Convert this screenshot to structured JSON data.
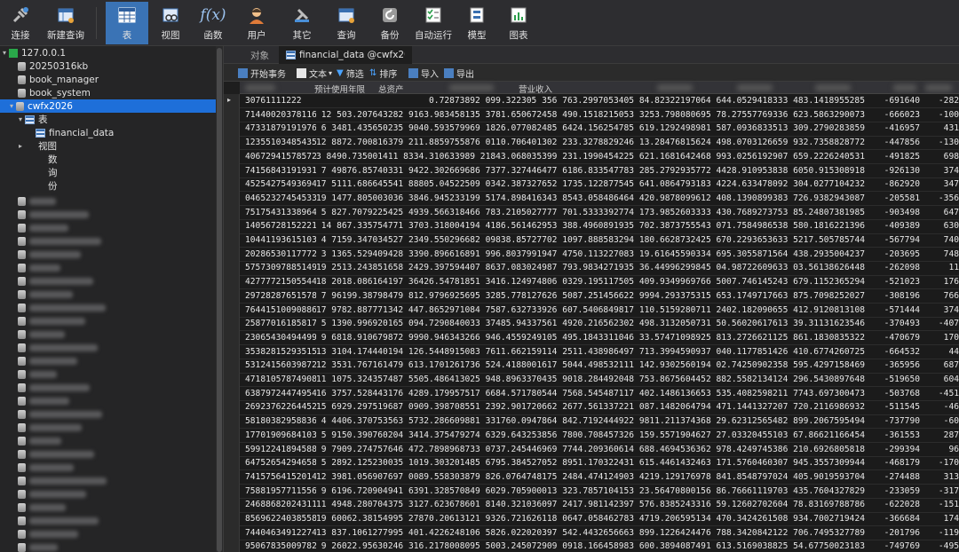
{
  "toolbar": {
    "items": [
      {
        "label": "连接",
        "icon": "connect-icon"
      },
      {
        "label": "新建查询",
        "icon": "new-query-icon"
      },
      {
        "label": "表",
        "icon": "table-icon"
      },
      {
        "label": "视图",
        "icon": "view-icon"
      },
      {
        "label": "函数",
        "icon": "function-icon"
      },
      {
        "label": "用户",
        "icon": "user-icon"
      },
      {
        "label": "其它",
        "icon": "other-icon"
      },
      {
        "label": "查询",
        "icon": "query-icon"
      },
      {
        "label": "备份",
        "icon": "backup-icon"
      },
      {
        "label": "自动运行",
        "icon": "auto-run-icon"
      },
      {
        "label": "模型",
        "icon": "model-icon"
      },
      {
        "label": "图表",
        "icon": "chart-icon"
      }
    ]
  },
  "sidebar": {
    "connection": "127.0.0.1",
    "databases": [
      "20250316kb",
      "book_manager",
      "book_system",
      "cwfx2026"
    ],
    "tables_label": "表",
    "table_name": "financial_data",
    "views_label": "视图",
    "functions_label": "数",
    "queries_label": "询",
    "backups_label": "份"
  },
  "tabs": {
    "objects": "对象",
    "active": "financial_data @cwfx2026 (127.0.0..."
  },
  "subtoolbar": {
    "begin_transaction": "开始事务",
    "text": "文本",
    "filter": "筛选",
    "sort": "排序",
    "import": "导入",
    "export": "导出"
  },
  "columns": {
    "c2": "预计使用年限",
    "c3": "总资产",
    "c4": "营业收入"
  },
  "rows": [
    {
      "id": "30761111222",
      "nums": "...",
      "n1": "-691640",
      "n2": "-282"
    },
    {
      "id": "71440020378116",
      "nums": "12 503.207643282 9163.983458135 3781.650672458 490.1518215053 3253.798080695 78.27557769336 623.5863290073",
      "n1": "-666023",
      "n2": "-100"
    },
    {
      "id": "47331879191976​2",
      "nums": "6 3481.435650235 9040.593579969 1826.077082485 6424.156254785 619.1292498981 587.0936833513 309.2790283859",
      "n1": "-416957",
      "n2": "431"
    },
    {
      "id": "12355103485435​4",
      "nums": "12 8872.700816379 211.8859755876 0110.706401302 233.3278829246 13.28476815624 498.0703126659 932.7358828772",
      "n1": "-447856",
      "n2": "-130"
    },
    {
      "id": "40672941578572",
      "nums": "3 8490.735001411 8334.310633989 21843.068035399 231.1990454225 621.1681642468 993.0256192907 659.2226240531",
      "n1": "-491825",
      "n2": "698"
    },
    {
      "id": "74156843191931",
      "nums": "7 49876.85740331 9422.302669686 7377.327446477 6186.833547783 285.2792935772 4428.910953838 6050.915308918",
      "n1": "-926130",
      "n2": "374"
    },
    {
      "id": "45254275493694",
      "nums": "17 5111.686645541 88805.04522509 0342.387327652 1735.122877545 641.0864793183 4224.633478092 304.0277104232",
      "n1": "-862920",
      "n2": "347"
    },
    {
      "id": "04652327454533",
      "nums": "19 1477.805003036 3846.945233199 5174.898416343 8543.058486464 420.9878099612 408.1390899383 726.9382943087",
      "n1": "-205581",
      "n2": "-356"
    },
    {
      "id": "75175431338964",
      "nums": "5 827.7079225425 4939.566318466 783.2105027777 701.5333392774 173.9852603333 430.7689273753 85.24807381985",
      "n1": "-903498",
      "n2": "647"
    },
    {
      "id": "14056728152221",
      "nums": "14 867.335754771 3703.318004194 4186.561462953 388.4960891935 702.3873755543 071.7584986538 580.1816221396",
      "n1": "-409389",
      "n2": "630"
    },
    {
      "id": "10441193615103​7",
      "nums": "4 7159.347034527 2349.550296682 09838.85727702 1097.888583294 180.6628732425 670.2293653633 5217.505785744",
      "n1": "-567794",
      "n2": "740"
    },
    {
      "id": "20286530117772",
      "nums": "3 1365.529409428 3390.896616891 996.8037991947 4750.113227083 19.61645590334 695.3055871564 438.2935004237",
      "n1": "-203695",
      "n2": "748"
    },
    {
      "id": "57573097885149",
      "nums": "19 2513.243851658 2429.397594407 8637.083024987 793.9834271935 36.44996299845 04.98722609633 03.56138626448",
      "n1": "-262098",
      "n2": "11"
    },
    {
      "id": "42777721505544​9",
      "nums": "18 2018.086164197 36426.54781851 3416.124974806 0329.195117505 409.9349969766 5007.746145243 679.1152365294",
      "n1": "-521023",
      "n2": "176"
    },
    {
      "id": "29728287651578",
      "nums": "7 96199.38798479 812.9796925695 3285.778127626 5087.251456622 9994.293375315 653.1749717663 875.7098252027",
      "n1": "-308196",
      "n2": "766"
    },
    {
      "id": "76441510090886​4",
      "nums": "17 9782.887771342 447.8652971084 7587.632733926 607.5406849817 110.5159280711 2402.182090655 412.9120813108",
      "n1": "-571444",
      "n2": "374"
    },
    {
      "id": "25877016185817",
      "nums": "5 1390.996920165 094.7290840033 37485.94337561 4920.216562302 498.3132050731 50.56020617613 39.31131623546",
      "n1": "-370493",
      "n2": "-407"
    },
    {
      "id": "23065430494499",
      "nums": "9 6818.910679872 9990.946343266 946.4559249105 495.1843311046 33.57471098925 813.2726621125 861.1830835322",
      "n1": "-470679",
      "n2": "170"
    },
    {
      "id": "35382815293515​3",
      "nums": "13 3104.174440194 126.5448915083 7611.662159114 2511.438986497 713.3994590937 040.1177851426 410.6774260725",
      "n1": "-664532",
      "n2": "44"
    },
    {
      "id": "53124156039872",
      "nums": "12 3531.767161479 613.1701261736 524.4188001617 5044.498532111 142.9302560194 02.74250902358 595.4297158469",
      "n1": "-365956",
      "n2": "687"
    },
    {
      "id": "47181057874908​7",
      "nums": "11 1075.324357487 5505.486413025 948.8963370435 9018.284492048 753.8675604452 882.5582134124 296.5430897648",
      "n1": "-519650",
      "n2": "604"
    },
    {
      "id": "63879724474954",
      "nums": "16 3757.528443176 4289.179957517 6684.571780544 7568.545487117 402.1486136653 535.4082598211 7743.697300473",
      "n1": "-503768",
      "n2": "-451"
    },
    {
      "id": "26923762264452​7",
      "nums": "15 6929.297519687 0909.398708551 2392.901720662 2677.561337221 087.1482064794 471.1441327207 720.2116986932",
      "n1": "-511545",
      "n2": "-46"
    },
    {
      "id": "58180382958836",
      "nums": "4 4406.370753563 5732.286609881 331760.0947864 842.7192444922 9811.211374368 29.62312565482 899.2067595494",
      "n1": "-737790",
      "n2": "-60"
    },
    {
      "id": "17701909684103",
      "nums": "5 9150.390760204 3414.375479274 6329.643253856 7800.708457326 159.5571904627 27.03320455103 67.86621166454",
      "n1": "-361553",
      "n2": "287"
    },
    {
      "id": "59912241894588",
      "nums": "9 7909.274757646 472.7898968733 0737.245446969 7744.209360614 688.4694536362 978.4249745386 210.6926805818",
      "n1": "-299394",
      "n2": "96"
    },
    {
      "id": "64752654294658",
      "nums": "5 2892.125230035 1019.303201485 6795.384527052 8951.170322431 615.4461432463 171.5760460307 945.3557309944",
      "n1": "-468179",
      "n2": "-170"
    },
    {
      "id": "74157564152014",
      "nums": "12 3981.056907697 0089.558303879 826.0764748175 2484.474124903 4219.129176978 841.8548797024 405.9019593704",
      "n1": "-274488",
      "n2": "313"
    },
    {
      "id": "75881957711556",
      "nums": "9 6196.720904941 6391.328570849 6029.705900013 323.7857104153 23.56470800156 86.76661119703 435.7604327829",
      "n1": "-233059",
      "n2": "-317"
    },
    {
      "id": "24688682024311",
      "nums": "11 4948.280704375 3127.623678601 8140.321036097 2417.981142397 576.8385243316 59.12602702604 78.83169788786",
      "n1": "-622028",
      "n2": "-151"
    },
    {
      "id": "85696224038558",
      "nums": "19 60062.38154995 27870.20613121 9326.721626118 0647.058462783 4719.206595134 470.3424261508 934.7002719424",
      "n1": "-366684",
      "n2": "174"
    },
    {
      "id": "74404634912274",
      "nums": "13 837.1061277995 401.4226248106 5826.022020397 542.4432656663 899.1226424476 788.3420842122 706.7495327789",
      "n1": "-201796",
      "n2": "-119"
    },
    {
      "id": "95067835009782",
      "nums": "9 26022.95630246 316.2178008095 5003.245072909 0918.166458983 600.3894087491 613.5169038825 54.67750023183",
      "n1": "-749769",
      "n2": "-495"
    }
  ],
  "first_row_nums": "0.72873892 099.322305                   356 763.2997053405 84.82322197064 644.0529418333 483.1418955285",
  "colors": {
    "accent": "#1e6fd9",
    "toolbar_active": "#3a73b5",
    "background": "#1e1e1e"
  }
}
